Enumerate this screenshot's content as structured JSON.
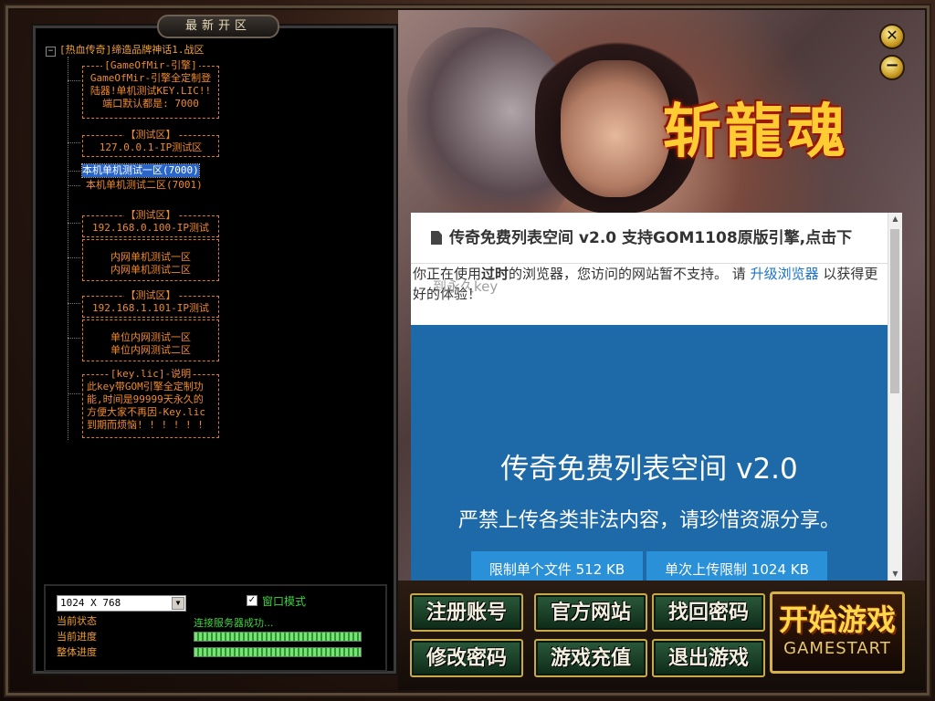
{
  "panel": {
    "title": "最新开区"
  },
  "tree": {
    "root": "[热血传奇]缔造品牌神话1.战区",
    "box1": {
      "title": "[GameOfMir-引擎]",
      "lines": [
        "GameOfMir-引擎全定制登",
        "陆器!单机测试KEY.LIC!!",
        "端口默认都是: 7000"
      ]
    },
    "box2": {
      "title": "【测试区】",
      "lines": [
        "127.0.0.1-IP测试区"
      ]
    },
    "server1": "本机单机测试一区(7000)",
    "server2": "本机单机测试二区(7001)",
    "box3": {
      "title": "【测试区】",
      "lines": [
        "192.168.0.100-IP测试"
      ]
    },
    "box4": {
      "lines": [
        "内网单机测试一区",
        "内网单机测试二区"
      ]
    },
    "box5": {
      "title": "【测试区】",
      "lines": [
        "192.168.1.101-IP测试"
      ]
    },
    "box6": {
      "lines": [
        "单位内网测试一区",
        "单位内网测试二区"
      ]
    },
    "box7": {
      "title": "[key.lic]-说明",
      "lines": [
        "此key带GOM引擎全定制功",
        "能,时间是99999天永久的",
        "方便大家不再因-Key.lic",
        "到期而烦恼! ! ! ! ! !"
      ]
    }
  },
  "settings": {
    "resolution": "1024 X 768",
    "window_mode_label": "窗口模式",
    "window_mode_checked": "✓",
    "current_status_label": "当前状态",
    "current_progress_label": "当前进度",
    "overall_progress_label": "整体进度",
    "status_text": "连接服务器成功...",
    "current_progress": 1.0,
    "overall_progress": 1.0
  },
  "art": {
    "logo_text": "斩龍魂"
  },
  "browser": {
    "header": "传奇免费列表空间 v2.0 支持GOM1108原版引擎,点击下",
    "notice_pre": "你正在使用",
    "notice_bold": "过时",
    "notice_mid": "的浏览器，您访问的网站暂不支持。 请 ",
    "notice_link": "升级浏览器",
    "notice_post": " 以获得更好的体验！",
    "overlay_text": "到永久key",
    "hero_title": "传奇免费列表空间 v2.0",
    "hero_subtitle": "严禁上传各类非法内容，请珍惜资源分享。",
    "button1": "限制单个文件 512 KB",
    "button2": "单次上传限制 1024 KB"
  },
  "buttons": {
    "register": "注册账号",
    "official_site": "官方网站",
    "recover_password": "找回密码",
    "change_password": "修改密码",
    "recharge": "游戏充值",
    "exit": "退出游戏",
    "start": "开始游戏",
    "start_sub": "GAMESTART"
  },
  "window_controls": {
    "close": "✕",
    "minimize": "−"
  },
  "colors": {
    "server_text": "#f08a2a",
    "status_green": "#3ed23e",
    "selected_bg": "#2a66c8",
    "browser_blue": "#1e6aa8"
  }
}
